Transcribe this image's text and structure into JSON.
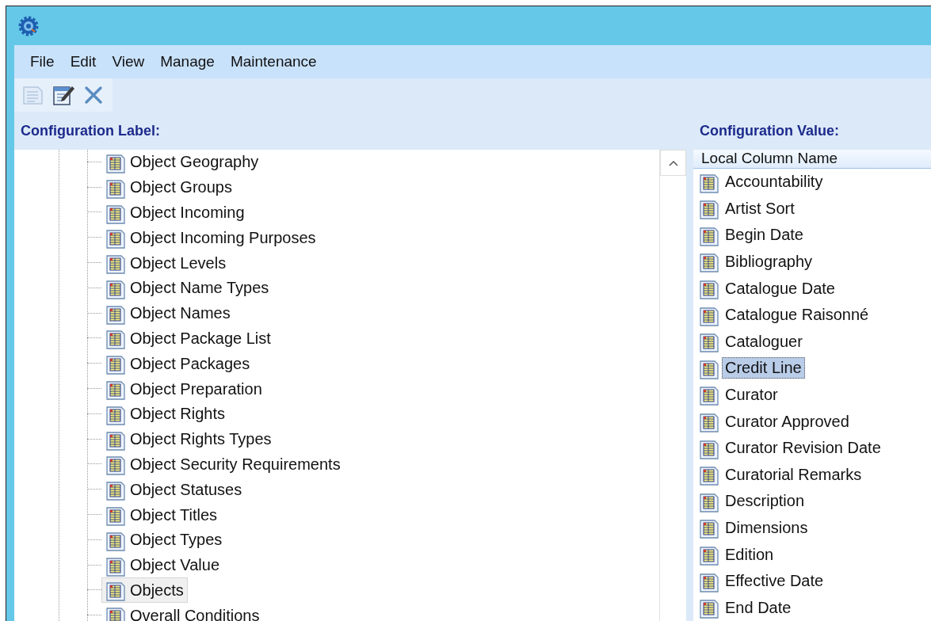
{
  "menu": [
    "File",
    "Edit",
    "View",
    "Manage",
    "Maintenance"
  ],
  "toolbar": [
    {
      "kind": "view",
      "disabled": true
    },
    {
      "kind": "edit",
      "disabled": false
    },
    {
      "kind": "delete",
      "disabled": false
    }
  ],
  "label_panel": {
    "heading": "Configuration Label:",
    "items": [
      {
        "label": "Object Geography",
        "selected": false
      },
      {
        "label": "Object Groups",
        "selected": false
      },
      {
        "label": "Object Incoming",
        "selected": false
      },
      {
        "label": "Object Incoming Purposes",
        "selected": false
      },
      {
        "label": "Object Levels",
        "selected": false
      },
      {
        "label": "Object Name Types",
        "selected": false
      },
      {
        "label": "Object Names",
        "selected": false
      },
      {
        "label": "Object Package List",
        "selected": false
      },
      {
        "label": "Object Packages",
        "selected": false
      },
      {
        "label": "Object Preparation",
        "selected": false
      },
      {
        "label": "Object Rights",
        "selected": false
      },
      {
        "label": "Object Rights Types",
        "selected": false
      },
      {
        "label": "Object Security Requirements",
        "selected": false
      },
      {
        "label": "Object Statuses",
        "selected": false
      },
      {
        "label": "Object Titles",
        "selected": false
      },
      {
        "label": "Object Types",
        "selected": false
      },
      {
        "label": "Object Value",
        "selected": false
      },
      {
        "label": "Objects",
        "selected": true
      },
      {
        "label": "Overall Conditions",
        "selected": false
      }
    ]
  },
  "value_panel": {
    "heading": "Configuration Value:",
    "column": "Local Column Name",
    "items": [
      {
        "label": "Accountability",
        "selected": false
      },
      {
        "label": "Artist Sort",
        "selected": false
      },
      {
        "label": "Begin Date",
        "selected": false
      },
      {
        "label": "Bibliography",
        "selected": false
      },
      {
        "label": "Catalogue Date",
        "selected": false
      },
      {
        "label": "Catalogue Raisonné",
        "selected": false
      },
      {
        "label": "Cataloguer",
        "selected": false
      },
      {
        "label": "Credit Line",
        "selected": true
      },
      {
        "label": "Curator",
        "selected": false
      },
      {
        "label": "Curator Approved",
        "selected": false
      },
      {
        "label": "Curator Revision Date",
        "selected": false
      },
      {
        "label": "Curatorial Remarks",
        "selected": false
      },
      {
        "label": "Description",
        "selected": false
      },
      {
        "label": "Dimensions",
        "selected": false
      },
      {
        "label": "Edition",
        "selected": false
      },
      {
        "label": "Effective Date",
        "selected": false
      },
      {
        "label": "End Date",
        "selected": false
      }
    ]
  }
}
